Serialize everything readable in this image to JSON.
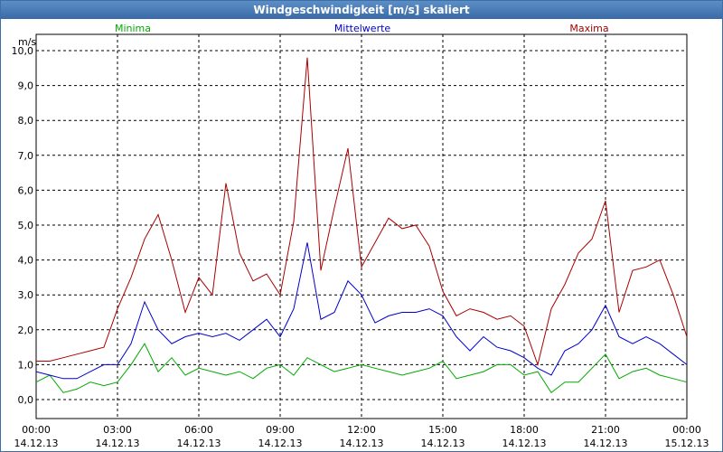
{
  "window": {
    "title": "Windgeschwindigkeit [m/s] skaliert"
  },
  "chart_data": {
    "type": "line",
    "title": "Windgeschwindigkeit [m/s] skaliert",
    "ylabel": "m/s",
    "ylim": [
      0,
      10
    ],
    "grid": true,
    "legend": "top",
    "y_ticks": [
      "0,0",
      "1,0",
      "2,0",
      "3,0",
      "4,0",
      "5,0",
      "6,0",
      "7,0",
      "8,0",
      "9,0",
      "10,0"
    ],
    "x_ticks": [
      {
        "time": "00:00",
        "date": "14.12.13"
      },
      {
        "time": "03:00",
        "date": "14.12.13"
      },
      {
        "time": "06:00",
        "date": "14.12.13"
      },
      {
        "time": "09:00",
        "date": "14.12.13"
      },
      {
        "time": "12:00",
        "date": "14.12.13"
      },
      {
        "time": "15:00",
        "date": "14.12.13"
      },
      {
        "time": "18:00",
        "date": "14.12.13"
      },
      {
        "time": "21:00",
        "date": "14.12.13"
      },
      {
        "time": "00:00",
        "date": "15.12.13"
      }
    ],
    "x_hours": [
      0.0,
      0.5,
      1.0,
      1.5,
      2.0,
      2.5,
      3.0,
      3.5,
      4.0,
      4.5,
      5.0,
      5.5,
      6.0,
      6.5,
      7.0,
      7.5,
      8.0,
      8.5,
      9.0,
      9.5,
      10.0,
      10.5,
      11.0,
      11.5,
      12.0,
      12.5,
      13.0,
      13.5,
      14.0,
      14.5,
      15.0,
      15.5,
      16.0,
      16.5,
      17.0,
      17.5,
      18.0,
      18.5,
      19.0,
      19.5,
      20.0,
      20.5,
      21.0,
      21.5,
      22.0,
      22.5,
      23.0,
      23.5,
      24.0
    ],
    "series": [
      {
        "name": "Minima",
        "color": "#00aa00",
        "values": [
          0.5,
          0.7,
          0.2,
          0.3,
          0.5,
          0.4,
          0.5,
          1.0,
          1.6,
          0.8,
          1.2,
          0.7,
          0.9,
          0.8,
          0.7,
          0.8,
          0.6,
          0.9,
          1.0,
          0.7,
          1.2,
          1.0,
          0.8,
          0.9,
          1.0,
          0.9,
          0.8,
          0.7,
          0.8,
          0.9,
          1.1,
          0.6,
          0.7,
          0.8,
          1.0,
          1.0,
          0.7,
          0.8,
          0.2,
          0.5,
          0.5,
          0.9,
          1.3,
          0.6,
          0.8,
          0.9,
          0.7,
          0.6,
          0.5
        ]
      },
      {
        "name": "Mittelwerte",
        "color": "#0000cc",
        "values": [
          0.8,
          0.7,
          0.6,
          0.6,
          0.8,
          1.0,
          1.0,
          1.6,
          2.8,
          2.0,
          1.6,
          1.8,
          1.9,
          1.8,
          1.9,
          1.7,
          2.0,
          2.3,
          1.8,
          2.6,
          4.5,
          2.3,
          2.5,
          3.4,
          3.0,
          2.2,
          2.4,
          2.5,
          2.5,
          2.6,
          2.4,
          1.8,
          1.4,
          1.8,
          1.5,
          1.4,
          1.2,
          0.9,
          0.7,
          1.4,
          1.6,
          2.0,
          2.7,
          1.8,
          1.6,
          1.8,
          1.6,
          1.3,
          1.0
        ]
      },
      {
        "name": "Maxima",
        "color": "#aa0000",
        "values": [
          1.1,
          1.1,
          1.2,
          1.3,
          1.4,
          1.5,
          2.6,
          3.5,
          4.6,
          5.3,
          4.0,
          2.5,
          3.5,
          3.0,
          6.2,
          4.2,
          3.4,
          3.6,
          3.0,
          5.1,
          9.8,
          3.7,
          5.5,
          7.2,
          3.8,
          4.5,
          5.2,
          4.9,
          5.0,
          4.4,
          3.1,
          2.4,
          2.6,
          2.5,
          2.3,
          2.4,
          2.1,
          1.0,
          2.6,
          3.3,
          4.2,
          4.6,
          5.7,
          2.5,
          3.7,
          3.8,
          4.0,
          3.0,
          1.8
        ]
      }
    ]
  }
}
